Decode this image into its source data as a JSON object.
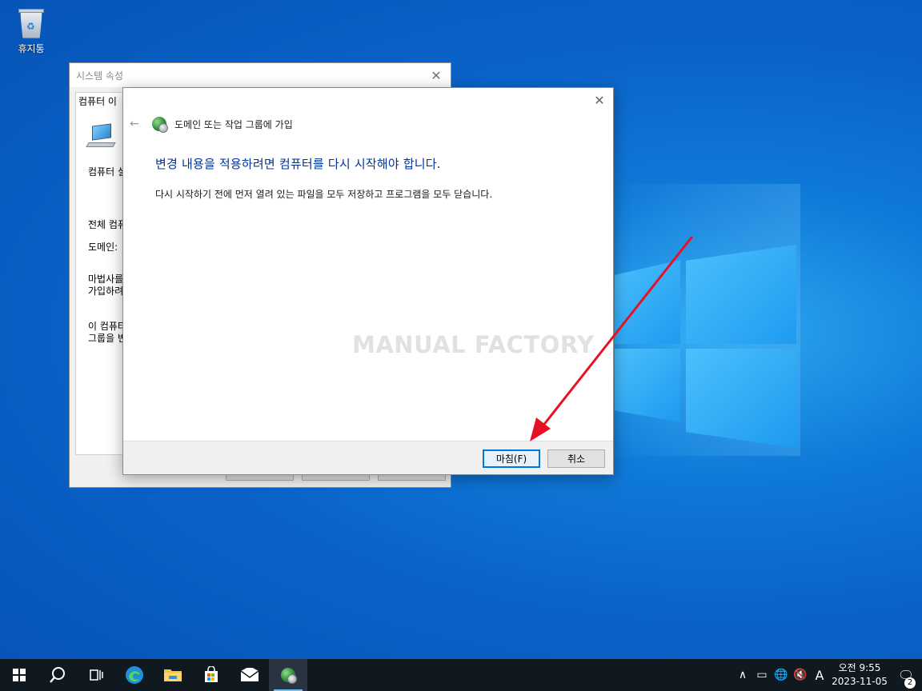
{
  "desktop": {
    "recycle_bin_label": "휴지통",
    "watermark": "MANUAL FACTORY"
  },
  "system_properties": {
    "title": "시스템 속성",
    "tab_label": "컴퓨터 이",
    "lines": [
      "컴퓨터 설",
      "전체 컴퓨",
      "도메인:",
      "마법사를",
      "가입하려",
      "이 컴퓨터",
      "그룹을 변"
    ]
  },
  "dialog": {
    "title": "도메인 또는 작업 그룹에 가입",
    "headline": "변경 내용을 적용하려면 컴퓨터를 다시 시작해야 합니다.",
    "body": "다시 시작하기 전에 먼저 열려 있는 파일을 모두 저장하고 프로그램을 모두 닫습니다.",
    "finish_label": "마침(F)",
    "cancel_label": "취소"
  },
  "taskbar": {
    "clock_time": "오전 9:55",
    "clock_date": "2023-11-05",
    "ime_label": "A",
    "notification_count": "2"
  },
  "colors": {
    "headline": "#003399",
    "accent": "#0078d7",
    "arrow": "#e81123"
  }
}
